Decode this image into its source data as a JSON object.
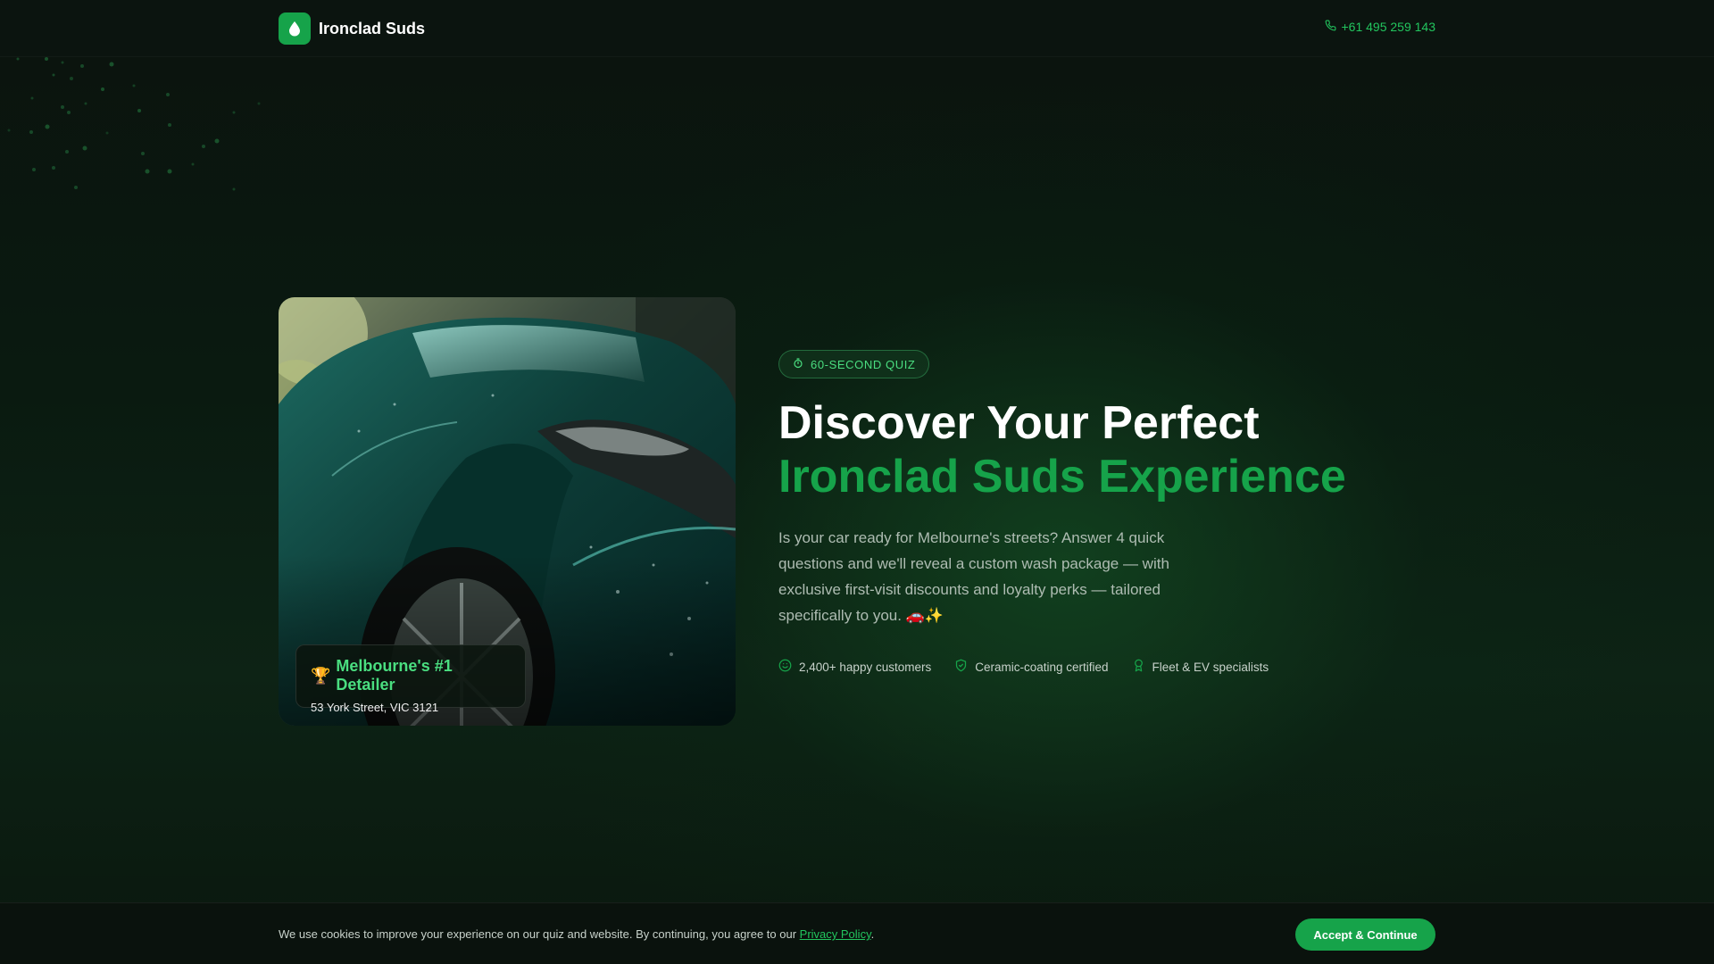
{
  "header": {
    "brand_name": "Ironclad Suds",
    "phone": "+61 495 259 143"
  },
  "hero": {
    "badge_title": "Melbourne's #1 Detailer",
    "badge_address": "53 York Street, VIC 3121"
  },
  "main": {
    "quiz_pill": "60-SECOND QUIZ",
    "headline_line1": "Discover Your Perfect",
    "headline_line2": "Ironclad Suds Experience",
    "description": "Is your car ready for Melbourne's streets? Answer 4 quick questions and we'll reveal a custom wash package — with exclusive first-visit discounts and loyalty perks — tailored specifically to you. 🚗✨",
    "trust_items": [
      {
        "icon": "smile-icon",
        "label": "2,400+ happy customers"
      },
      {
        "icon": "shield-check-icon",
        "label": "Ceramic-coating certified"
      },
      {
        "icon": "award-icon",
        "label": "Fleet & EV specialists"
      }
    ]
  },
  "cookie": {
    "text_before": "We use cookies to improve your experience on our quiz and website. By continuing, you agree to our ",
    "link": "Privacy Policy",
    "text_after": ".",
    "accept_label": "Accept & Continue"
  },
  "colors": {
    "accent": "#16a34a",
    "accent_light": "#4ade80",
    "background": "#0b140f"
  }
}
